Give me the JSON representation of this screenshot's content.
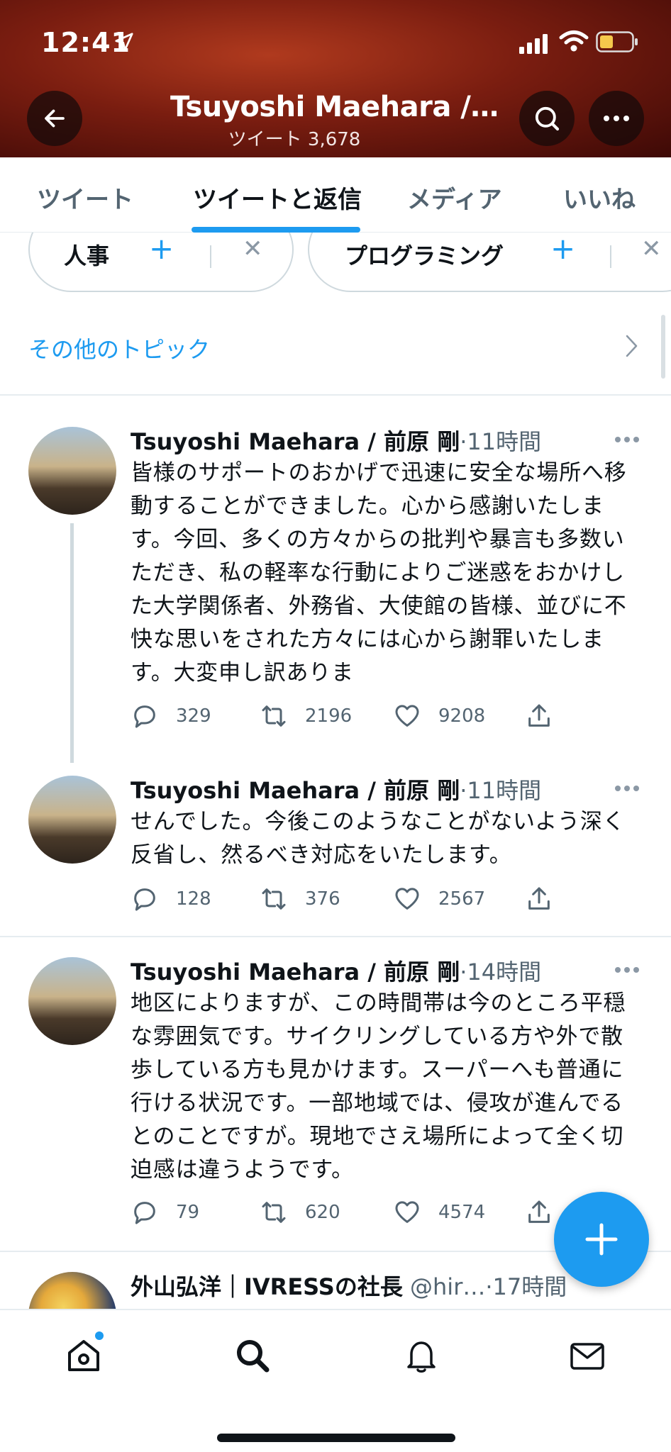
{
  "status_bar": {
    "time": "12:41",
    "icons": [
      "location-arrow-icon",
      "signal-icon",
      "wifi-icon",
      "battery-icon"
    ]
  },
  "header": {
    "title": "Tsuyoshi Maehara /…",
    "subtitle": "ツイート 3,678",
    "buttons": [
      "back-icon",
      "search-icon",
      "more-icon"
    ]
  },
  "tabs": [
    {
      "label": "ツイート",
      "active": false
    },
    {
      "label": "ツイートと返信",
      "active": true
    },
    {
      "label": "メディア",
      "active": false
    },
    {
      "label": "いいね",
      "active": false
    }
  ],
  "topics": {
    "chips": [
      {
        "label": "人事"
      },
      {
        "label": "プログラミング"
      }
    ],
    "other_topics_label": "その他のトピック"
  },
  "tweets": [
    {
      "name": "Tsuyoshi Maehara / 前原 剛",
      "time": "11時間",
      "text": "皆様のサポートのおかげで迅速に安全な場所へ移動することができました。心から感謝いたします。今回、多くの方々からの批判や暴言も多数いただき、私の軽率な行動によりご迷惑をおかけした大学関係者、外務省、大使館の皆様、並びに不快な思いをされた方々には心から謝罪いたします。大変申し訳ありま",
      "replies": "329",
      "retweets": "2196",
      "likes": "9208"
    },
    {
      "name": "Tsuyoshi Maehara / 前原 剛",
      "time": "11時間",
      "text": "せんでした。今後このようなことがないよう深く反省し、然るべき対応をいたします。",
      "replies": "128",
      "retweets": "376",
      "likes": "2567"
    },
    {
      "name": "Tsuyoshi Maehara / 前原 剛",
      "time": "14時間",
      "text": "地区によりますが、この時間帯は今のところ平穏な雰囲気です。サイクリングしている方や外で散歩している方も見かけます。スーパーへも普通に行ける状況です。一部地域では、侵攻が進んでるとのことですが。現地でさえ場所によって全く切迫感は違うようです。",
      "replies": "79",
      "retweets": "620",
      "likes": "4574"
    },
    {
      "name": "外山弘洋｜IVRESSの社長",
      "handle": "@hir…",
      "time": "17時間"
    }
  ],
  "fab": {
    "icon": "plus-icon"
  },
  "bottom_nav": [
    "home-icon",
    "search-icon",
    "notifications-bell-icon",
    "messages-envelope-icon"
  ],
  "colors": {
    "accent": "#1d9bf0",
    "banner": "#7a1d10",
    "text": "#0f1419",
    "muted": "#536471"
  }
}
